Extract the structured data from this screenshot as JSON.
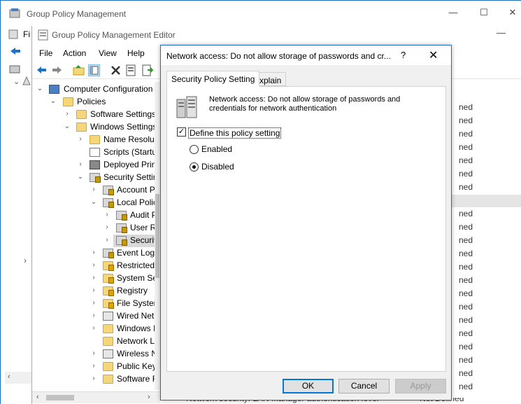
{
  "gpm": {
    "title": "Group Policy Management",
    "menu_fragment": "Fi"
  },
  "editor": {
    "title": "Group Policy Management Editor",
    "menu": [
      "File",
      "Action",
      "View",
      "Help"
    ],
    "tree": [
      {
        "label": "Computer Configuration",
        "indent": 0
      },
      {
        "label": "Policies",
        "indent": 1
      },
      {
        "label": "Software Settings",
        "indent": 2
      },
      {
        "label": "Windows Settings",
        "indent": 2
      },
      {
        "label": "Name Resolut",
        "indent": 3
      },
      {
        "label": "Scripts (Startu",
        "indent": 3
      },
      {
        "label": "Deployed Prin",
        "indent": 3
      },
      {
        "label": "Security Settin",
        "indent": 3
      },
      {
        "label": "Account P",
        "indent": 4
      },
      {
        "label": "Local Polic",
        "indent": 4
      },
      {
        "label": "Audit P",
        "indent": 5
      },
      {
        "label": "User Ri",
        "indent": 5
      },
      {
        "label": "Securit",
        "indent": 5
      },
      {
        "label": "Event Log",
        "indent": 4
      },
      {
        "label": "Restricted",
        "indent": 4
      },
      {
        "label": "System Se",
        "indent": 4
      },
      {
        "label": "Registry",
        "indent": 4
      },
      {
        "label": "File Systen",
        "indent": 4
      },
      {
        "label": "Wired Net",
        "indent": 4
      },
      {
        "label": "Windows I",
        "indent": 4
      },
      {
        "label": "Network L",
        "indent": 4
      },
      {
        "label": "Wireless N",
        "indent": 4
      },
      {
        "label": "Public Key",
        "indent": 4
      },
      {
        "label": "Software R",
        "indent": 4
      }
    ],
    "right_header": "tting",
    "right_items": [
      "ned",
      "ned",
      "ned",
      "ned",
      "ned",
      "ned",
      "ned",
      "ned",
      "ned",
      "ned",
      "ned",
      "ned",
      "ned",
      "ned",
      "ned",
      "ned",
      "ned",
      "ned",
      "ned",
      "ned",
      "ned"
    ],
    "bottom_row": "Network security: LAN Manager authentication level",
    "bottom_row_value": "Not Defined"
  },
  "dialog": {
    "title": "Network access: Do not allow storage of passwords and cr...",
    "help": "?",
    "close": "✕",
    "tabs": [
      "Security Policy Setting",
      "Explain"
    ],
    "policy_name": "Network access: Do not allow storage of passwords and credentials for network authentication",
    "define_label": "Define this policy setting",
    "define_checked": true,
    "options": [
      "Enabled",
      "Disabled"
    ],
    "selected_option": "Disabled",
    "buttons": {
      "ok": "OK",
      "cancel": "Cancel",
      "apply": "Apply"
    }
  }
}
